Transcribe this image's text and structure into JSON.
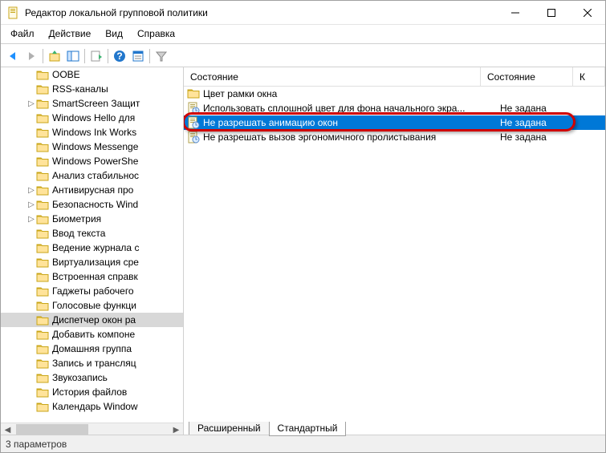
{
  "window": {
    "title": "Редактор локальной групповой политики"
  },
  "menus": {
    "file": "Файл",
    "action": "Действие",
    "view": "Вид",
    "help": "Справка"
  },
  "tree": {
    "items": [
      {
        "label": "OOBE",
        "expandable": false
      },
      {
        "label": "RSS-каналы",
        "expandable": false
      },
      {
        "label": "SmartScreen Защит",
        "expandable": true
      },
      {
        "label": "Windows Hello для",
        "expandable": false
      },
      {
        "label": "Windows Ink Works",
        "expandable": false
      },
      {
        "label": "Windows Messenge",
        "expandable": false
      },
      {
        "label": "Windows PowerShe",
        "expandable": false
      },
      {
        "label": "Анализ стабильнос",
        "expandable": false
      },
      {
        "label": "Антивирусная про",
        "expandable": true
      },
      {
        "label": "Безопасность Wind",
        "expandable": true
      },
      {
        "label": "Биометрия",
        "expandable": true
      },
      {
        "label": "Ввод текста",
        "expandable": false
      },
      {
        "label": "Ведение журнала с",
        "expandable": false
      },
      {
        "label": "Виртуализация сре",
        "expandable": false
      },
      {
        "label": "Встроенная справк",
        "expandable": false
      },
      {
        "label": "Гаджеты рабочего",
        "expandable": false
      },
      {
        "label": "Голосовые функци",
        "expandable": false
      },
      {
        "label": "Диспетчер окон ра",
        "expandable": false,
        "selected": true
      },
      {
        "label": "Добавить компоне",
        "expandable": false
      },
      {
        "label": "Домашняя группа",
        "expandable": false
      },
      {
        "label": "Запись и трансляц",
        "expandable": false
      },
      {
        "label": "Звукозапись",
        "expandable": false
      },
      {
        "label": "История файлов",
        "expandable": false
      },
      {
        "label": "Календарь Window",
        "expandable": false
      }
    ]
  },
  "list": {
    "columns": {
      "c1": "Состояние",
      "c2": "Состояние",
      "c3": "К"
    },
    "rows": [
      {
        "type": "folder",
        "label": "Цвет рамки окна",
        "state": ""
      },
      {
        "type": "policy",
        "label": "Использовать сплошной цвет для фона начального экра...",
        "state": "Не задана"
      },
      {
        "type": "policy",
        "label": "Не разрешать анимацию окон",
        "state": "Не задана",
        "selected": true,
        "highlighted": true
      },
      {
        "type": "policy",
        "label": "Не разрешать вызов эргономичного пролистывания",
        "state": "Не задана"
      }
    ]
  },
  "tabs": {
    "extended": "Расширенный",
    "standard": "Стандартный"
  },
  "status": {
    "text": "3 параметров"
  }
}
